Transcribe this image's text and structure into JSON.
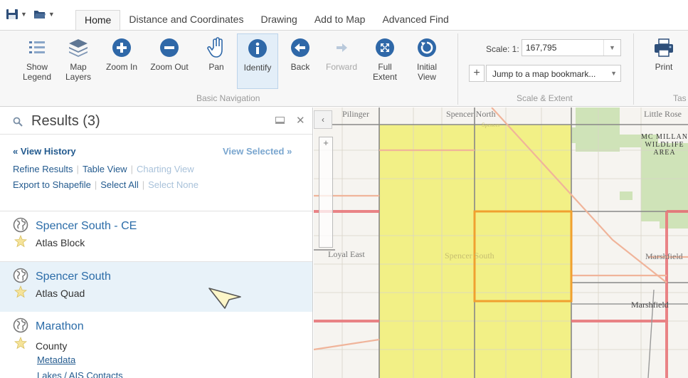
{
  "tabs": [
    {
      "label": "Home",
      "active": true
    },
    {
      "label": "Distance and Coordinates"
    },
    {
      "label": "Drawing"
    },
    {
      "label": "Add to Map"
    },
    {
      "label": "Advanced Find"
    }
  ],
  "ribbon": {
    "buttons": {
      "show_legend": {
        "line1": "Show",
        "line2": "Legend"
      },
      "map_layers": {
        "line1": "Map",
        "line2": "Layers"
      },
      "zoom_in": {
        "line1": "Zoom In"
      },
      "zoom_out": {
        "line1": "Zoom Out"
      },
      "pan": {
        "line1": "Pan"
      },
      "identify": {
        "line1": "Identify"
      },
      "back": {
        "line1": "Back"
      },
      "forward": {
        "line1": "Forward"
      },
      "full_extent": {
        "line1": "Full",
        "line2": "Extent"
      },
      "initial_view": {
        "line1": "Initial",
        "line2": "View"
      },
      "print": {
        "line1": "Print"
      }
    },
    "groups": {
      "basic_navigation": "Basic Navigation",
      "scale_extent": "Scale & Extent",
      "tasks_partial": "Tas"
    },
    "scale": {
      "label": "Scale: 1:",
      "value": "167,795"
    },
    "bookmark": {
      "placeholder": "Jump to a map bookmark..."
    }
  },
  "results": {
    "title": "Results (3)",
    "view_history": "View History",
    "view_selected": "View Selected",
    "links": {
      "refine": "Refine Results",
      "table_view": "Table View",
      "charting_view": "Charting View",
      "export": "Export to Shapefile",
      "select_all": "Select All",
      "select_none": "Select None"
    },
    "items": [
      {
        "name": "Spencer South - CE",
        "type": "Atlas Block"
      },
      {
        "name": "Spencer South",
        "type": "Atlas Quad"
      },
      {
        "name": "Marathon",
        "type": "County",
        "links": [
          "Metadata",
          "Lakes / AIS Contacts"
        ]
      }
    ]
  },
  "map": {
    "labels": {
      "pilinger": "Pilinger",
      "spencer_north": "Spencer North",
      "spencer_small": "Spencer",
      "little_rose": "Little Rose",
      "loyal_east": "Loyal East",
      "spencer_south": "Spencer South",
      "marshfield_quad": "Marshfield",
      "marshfield_city": "Marshfield"
    },
    "wildlife_area": [
      "MC MILLAN",
      "WILDLIFE",
      "AREA"
    ]
  },
  "colors": {
    "accent": "#245b8f",
    "selection_fill": "#f2f07a",
    "highlight_block": "#f0a030",
    "county_line": "#e8777a",
    "road": "#f0b49a",
    "forest": "#cfe3b8"
  }
}
